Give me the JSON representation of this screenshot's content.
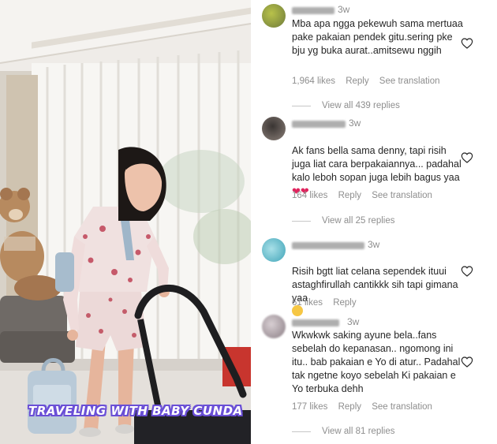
{
  "photo": {
    "caption": "TRAVELING WITH BABY CUNDA",
    "colors": {
      "caption_outline": "#6a4fd6",
      "caption_fill": "#ffffff"
    }
  },
  "comments": [
    {
      "time": "3w",
      "text": "Mba apa ngga pekewuh sama mertuaa pake pakaian pendek gitu.sering pke bju yg buka aurat..amitsewu nggih",
      "likes": "1,964 likes",
      "reply": "Reply",
      "see_translation": "See translation",
      "view_replies": "View all 439 replies"
    },
    {
      "time": "3w",
      "text": "Ak fans bella sama denny, tapi risih juga liat cara berpakaiannya... padahal kalo leboh sopan juga lebih bagus yaa",
      "text_suffix": "❤❤",
      "likes": "164 likes",
      "reply": "Reply",
      "see_translation": "See translation",
      "view_replies": "View all 25 replies"
    },
    {
      "time": "3w",
      "text": "Risih bgtt liat celana sependek ituui astaghfirullah cantikkk sih tapi gimana yaa",
      "likes": "61 likes",
      "reply": "Reply"
    },
    {
      "time": "3w",
      "text": "Wkwkwk saking ayune bela..fans sebelah do kepanasan.. ngomong ini itu.. bab pakaian e Yo di atur.. Padahal tak ngetne koyo sebelah Ki pakaian e Yo terbuka dehh",
      "likes": "177 likes",
      "reply": "Reply",
      "see_translation": "See translation",
      "view_replies": "View all 81 replies"
    }
  ]
}
